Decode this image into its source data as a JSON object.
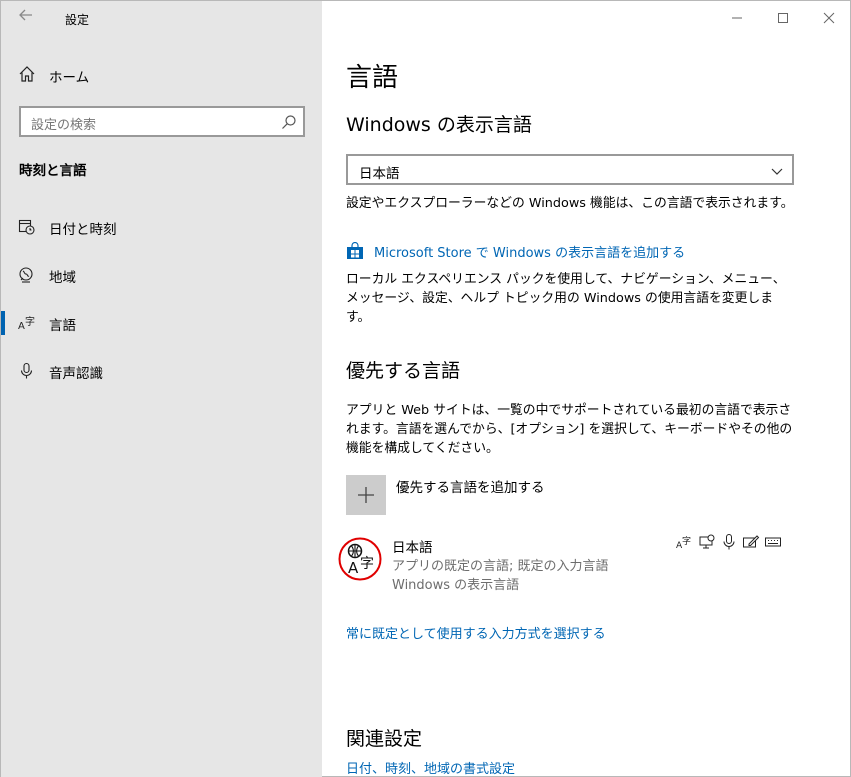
{
  "window": {
    "title": "設定"
  },
  "sidebar": {
    "home_label": "ホーム",
    "search_placeholder": "設定の検索",
    "section_title": "時刻と言語",
    "items": [
      {
        "label": "日付と時刻",
        "icon": "date-time-icon",
        "active": false
      },
      {
        "label": "地域",
        "icon": "region-icon",
        "active": false
      },
      {
        "label": "言語",
        "icon": "language-icon",
        "active": true
      },
      {
        "label": "音声認識",
        "icon": "microphone-icon",
        "active": false
      }
    ]
  },
  "main": {
    "title": "言語",
    "display_language": {
      "heading": "Windows の表示言語",
      "selected": "日本語",
      "description": "設定やエクスプローラーなどの Windows 機能は、この言語で表示されます。",
      "store_link": "Microsoft Store で Windows の表示言語を追加する",
      "store_description": "ローカル エクスペリエンス パックを使用して、ナビゲーション、メニュー、メッセージ、設定、ヘルプ トピック用の Windows の使用言語を変更します。"
    },
    "preferred_languages": {
      "heading": "優先する言語",
      "description": "アプリと Web サイトは、一覧の中でサポートされている最初の言語で表示されます。言語を選んでから、[オプション] を選択して、キーボードやその他の機能を構成してください。",
      "add_label": "優先する言語を追加する",
      "languages": [
        {
          "name": "日本語",
          "line1": "アプリの既定の言語; 既定の入力言語",
          "line2": "Windows の表示言語",
          "feature_icons": [
            "display-language-icon",
            "speech-recognition-icon",
            "microphone-icon",
            "handwriting-icon",
            "keyboard-icon"
          ]
        }
      ],
      "default_input_link": "常に既定として使用する入力方式を選択する"
    },
    "related": {
      "heading": "関連設定",
      "link": "日付、時刻、地域の書式設定"
    }
  },
  "colors": {
    "accent": "#0063b1",
    "link": "#0066b4",
    "sidebar_bg": "#e6e6e6",
    "highlight_circle": "#e00000"
  }
}
